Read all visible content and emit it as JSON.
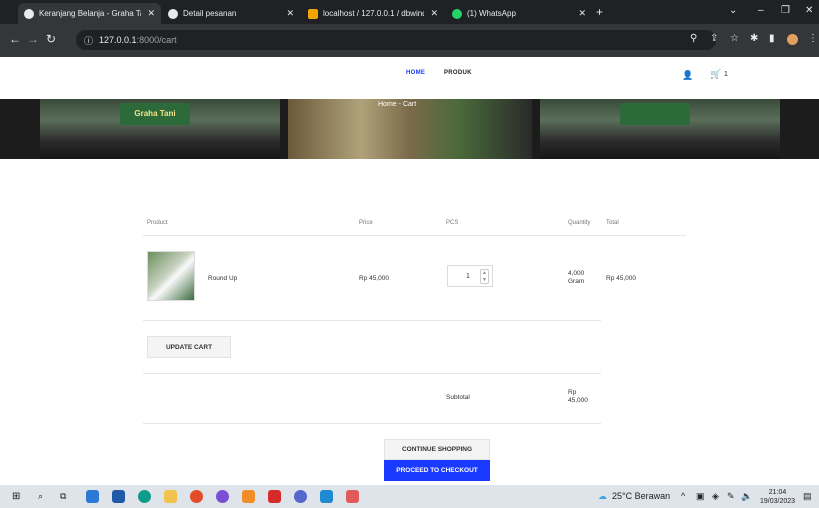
{
  "browser": {
    "tabs": [
      {
        "title": "Keranjang Belanja - Graha Tani",
        "active": true
      },
      {
        "title": "Detail pesanan",
        "active": false
      },
      {
        "title": "localhost / 127.0.0.1 / dbwinda |",
        "active": false
      },
      {
        "title": "(1) WhatsApp",
        "active": false
      }
    ],
    "url_host": "127.0.0.1",
    "url_path": ":8000/cart"
  },
  "site": {
    "nav": {
      "home": "HOME",
      "produk": "PRODUK"
    },
    "cart_count": "1",
    "breadcrumb": {
      "home": "Home",
      "sep": "-",
      "current": "Cart"
    },
    "hero_sign_1": "Graha Tani"
  },
  "cart": {
    "headers": {
      "product": "Product",
      "price": "Price",
      "pcs": "PCS",
      "quantity": "Quantity",
      "total": "Total"
    },
    "items": [
      {
        "name": "Round Up",
        "price": "Rp 45,000",
        "pcs": "1",
        "quantity": "4,000 Gram",
        "total": "Rp 45,000"
      }
    ],
    "update_label": "UPDATE CART",
    "subtotal_label": "Subtotal",
    "subtotal_value": "Rp 45,000",
    "continue_label": "CONTINUE SHOPPING",
    "checkout_label": "PROCEED TO CHECKOUT"
  },
  "taskbar": {
    "weather": "25°C  Berawan",
    "time": "21:04",
    "date": "19/03/2023"
  },
  "colors": {
    "accent": "#1a3bff",
    "nav_active": "#1a3bff"
  }
}
